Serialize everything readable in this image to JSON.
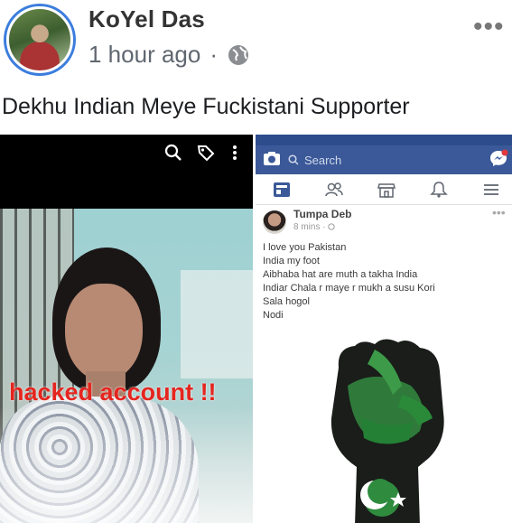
{
  "post": {
    "author": "KoYel Das",
    "time": "1 hour ago",
    "separator": "·",
    "more": "•••",
    "text": "Dekhu Indian Meye Fuckistani Supporter"
  },
  "photo": {
    "overlay_text": "hacked account !!",
    "overlay_color": "#e5251f"
  },
  "phone": {
    "nav_color": "#3b5998",
    "search_placeholder": "Search",
    "inner_post": {
      "author": "Tumpa Deb",
      "meta": "8 mins · ",
      "lines": [
        "I love you Pakistan",
        "India my foot",
        "Aibhaba hat are muth a takha India",
        "Indiar Chala r maye r mukh a susu Kori",
        "Sala hogol",
        "Nodi"
      ]
    }
  }
}
